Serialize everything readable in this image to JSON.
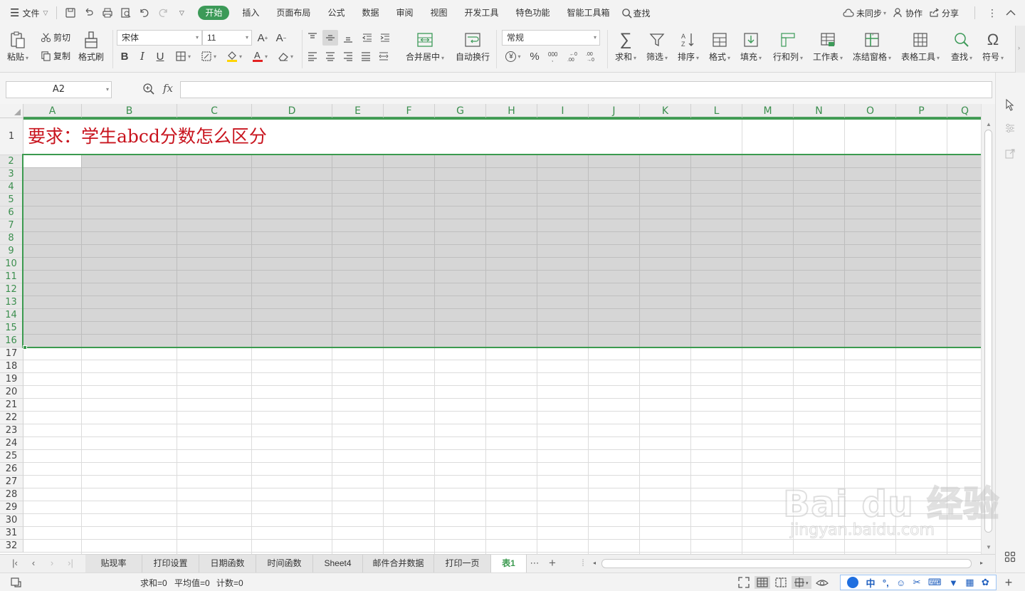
{
  "menubar": {
    "file_label": "文件",
    "tabs": [
      {
        "id": "home",
        "label": "开始",
        "active": true
      },
      {
        "id": "insert",
        "label": "插入"
      },
      {
        "id": "layout",
        "label": "页面布局"
      },
      {
        "id": "formula",
        "label": "公式"
      },
      {
        "id": "data",
        "label": "数据"
      },
      {
        "id": "review",
        "label": "审阅"
      },
      {
        "id": "view",
        "label": "视图"
      },
      {
        "id": "dev",
        "label": "开发工具"
      },
      {
        "id": "special",
        "label": "特色功能"
      },
      {
        "id": "smart",
        "label": "智能工具箱"
      }
    ],
    "search_label": "查找",
    "sync_label": "未同步",
    "collab_label": "协作",
    "share_label": "分享",
    "accent_color": "#3c9a58"
  },
  "ribbon": {
    "paste": "粘贴",
    "cut": "剪切",
    "copy": "复制",
    "format_painter": "格式刷",
    "font_name": "宋体",
    "font_size": "11",
    "bold": "B",
    "italic": "I",
    "underline": "U",
    "merge_center": "合并居中",
    "wrap_text": "自动换行",
    "number_format": "常规",
    "percent": "%",
    "sum": "求和",
    "filter": "筛选",
    "sort": "排序",
    "format": "格式",
    "fill": "填充",
    "row_col": "行和列",
    "worksheet": "工作表",
    "freeze": "冻结窗格",
    "table_tools": "表格工具",
    "find": "查找",
    "symbol": "符号"
  },
  "formula_bar": {
    "name_box": "A2",
    "fx_label": "fx",
    "formula": ""
  },
  "grid": {
    "columns": [
      "A",
      "B",
      "C",
      "D",
      "E",
      "F",
      "G",
      "H",
      "I",
      "J",
      "K",
      "L",
      "M",
      "N",
      "O",
      "P",
      "Q"
    ],
    "rows": [
      "1",
      "2",
      "3",
      "4",
      "5",
      "6",
      "7",
      "8",
      "9",
      "10",
      "11",
      "12",
      "13",
      "14",
      "15",
      "16",
      "17",
      "18",
      "19",
      "20",
      "21",
      "22",
      "23",
      "24",
      "25",
      "26",
      "27",
      "28",
      "29",
      "30",
      "31",
      "32"
    ],
    "cell_a1": "要求：学生abcd分数怎么区分",
    "a1_color": "#c8141e",
    "selection": "A2:Q16",
    "selection_color": "#3b9a4f"
  },
  "sheets": {
    "tabs": [
      "贴现率",
      "打印设置",
      "日期函数",
      "时间函数",
      "Sheet4",
      "邮件合并数据",
      "打印一页",
      "表1"
    ],
    "active": "表1",
    "more": "⋯",
    "add": "+"
  },
  "status": {
    "sum": "求和=0",
    "average": "平均值=0",
    "count": "计数=0"
  },
  "ime": [
    "中"
  ],
  "watermark": {
    "logo": "Bai du 经验",
    "url": "jingyan.baidu.com"
  }
}
